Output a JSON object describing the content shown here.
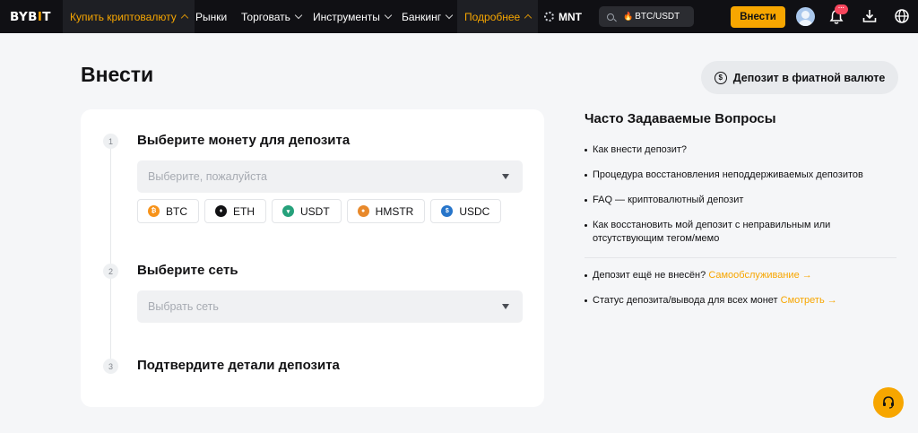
{
  "nav": {
    "logo_left": "BYB",
    "logo_bar": "I",
    "logo_right": "T",
    "items": [
      {
        "label": "Купить криптовалюту"
      },
      {
        "label": "Рынки"
      },
      {
        "label": "Торговать"
      },
      {
        "label": "Инструменты"
      },
      {
        "label": "Банкинг"
      },
      {
        "label": "Подробнее"
      }
    ],
    "mnt_label": "MNT",
    "search_text": "BTC/USDT",
    "deposit_label": "Внести",
    "badge_text": "···"
  },
  "page": {
    "title": "Внести",
    "fiat_button": "Депозит в фиатной валюте",
    "fiat_icon": "$"
  },
  "steps": [
    {
      "num": "1",
      "title": "Выберите монету для депозита",
      "placeholder": "Выберите, пожалуйста"
    },
    {
      "num": "2",
      "title": "Выберите сеть",
      "placeholder": "Выбрать сеть"
    },
    {
      "num": "3",
      "title": "Подтвердите детали депозита"
    }
  ],
  "coins": [
    {
      "symbol": "BTC",
      "color": "#f7931a",
      "glyph": "₿"
    },
    {
      "symbol": "ETH",
      "color": "#121214",
      "glyph": "♦"
    },
    {
      "symbol": "USDT",
      "color": "#26a17b",
      "glyph": "▾"
    },
    {
      "symbol": "HMSTR",
      "color": "#e8892b",
      "glyph": "●"
    },
    {
      "symbol": "USDC",
      "color": "#2775ca",
      "glyph": "$"
    }
  ],
  "faq": {
    "title": "Часто Задаваемые Вопросы",
    "items": [
      "Как внести депозит?",
      "Процедура восстановления неподдерживаемых депозитов",
      "FAQ — криптовалютный депозит",
      "Как восстановить мой депозит с неправильным или отсутствующим тегом/мемо"
    ],
    "self_service_text": "Депозит ещё не внесён?",
    "self_service_link": "Самообслуживание →",
    "status_text": "Статус депозита/вывода для всех монет",
    "status_link": "Смотреть →"
  },
  "colors": {
    "accent": "#f7a600",
    "nav_bg": "#101014",
    "page_bg": "#f5f6f8"
  }
}
